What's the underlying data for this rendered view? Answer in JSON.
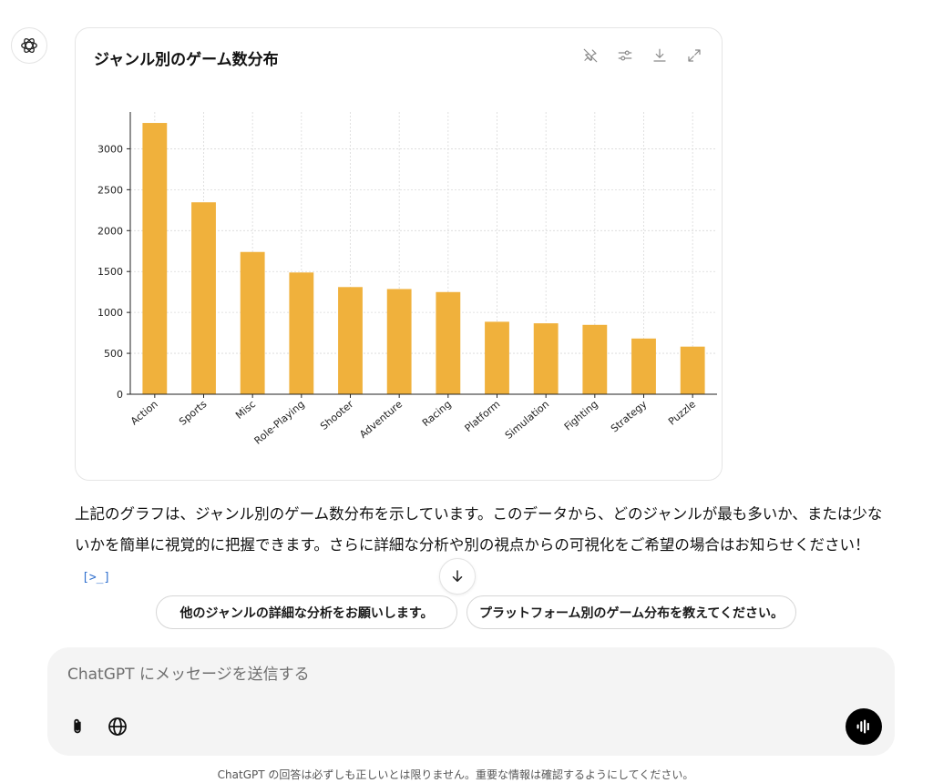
{
  "chart_card": {
    "title": "ジャンル別のゲーム数分布",
    "tools": [
      "pin-icon",
      "sliders-icon",
      "download-icon",
      "expand-icon"
    ]
  },
  "chart_data": {
    "type": "bar",
    "title": "",
    "xlabel": "",
    "ylabel": "",
    "categories": [
      "Action",
      "Sports",
      "Misc",
      "Role-Playing",
      "Shooter",
      "Adventure",
      "Racing",
      "Platform",
      "Simulation",
      "Fighting",
      "Strategy",
      "Puzzle"
    ],
    "values": [
      3316,
      2346,
      1739,
      1488,
      1310,
      1286,
      1249,
      886,
      867,
      848,
      681,
      582
    ],
    "ylim": [
      0,
      3450
    ],
    "yticks": [
      0,
      500,
      1000,
      1500,
      2000,
      2500,
      3000
    ],
    "bar_color": "#f0b13c",
    "grid": true
  },
  "response": {
    "text": "上記のグラフは、ジャンル別のゲーム数分布を示しています。このデータから、どのジャンルが最も多いか、または少ないかを簡単に視覚的に把握できます。さらに詳細な分析や別の視点からの可視化をご希望の場合はお知らせください！",
    "code_ref": "[>_]"
  },
  "suggestions": [
    "他のジャンルの詳細な分析をお願いします。",
    "プラットフォーム別のゲーム分布を教えてください。"
  ],
  "composer": {
    "placeholder": "ChatGPT にメッセージを送信する",
    "value": ""
  },
  "disclaimer": "ChatGPT の回答は必ずしも正しいとは限りません。重要な情報は確認するようにしてください。"
}
